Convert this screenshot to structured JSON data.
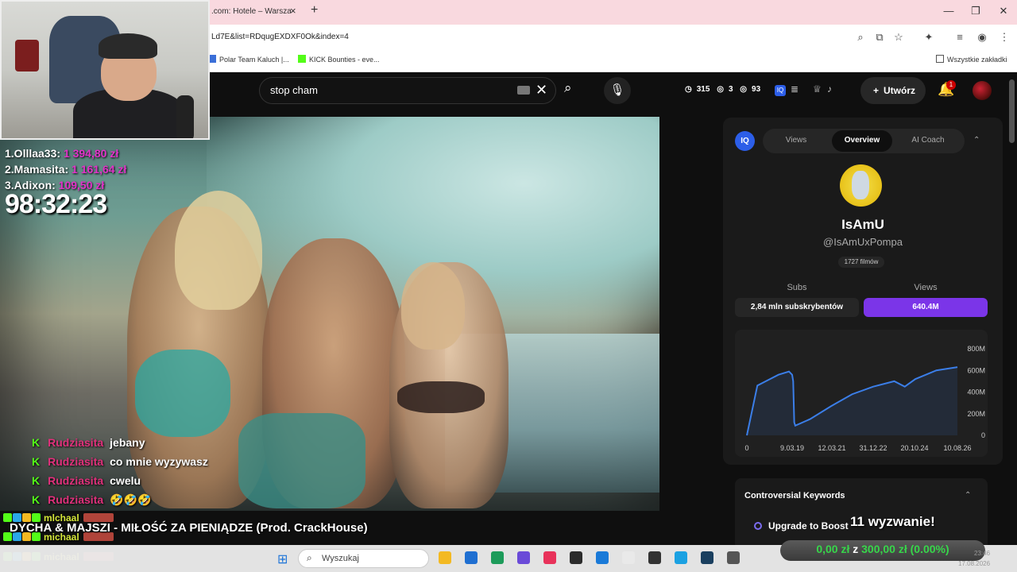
{
  "browser": {
    "tab_title": ".com: Hotele – Warsza",
    "tab_close": "×",
    "new_tab": "+",
    "window_controls": {
      "minimize": "—",
      "maximize": "❐",
      "close": "✕"
    },
    "url": "Ld7E&list=RDqugEXDXF0Ok&index=4",
    "bookmarks": [
      {
        "label": "Polar Team Kaluch |...",
        "icon": "bookmark-page-icon",
        "color": "#3b6fd8"
      },
      {
        "label": "KICK Bounties - eve...",
        "icon": "kick-icon",
        "color": "#53fc18"
      }
    ],
    "all_bookmarks": "Wszystkie zakładki"
  },
  "youtube": {
    "search_value": "stop cham",
    "stats": {
      "watch_time": "315",
      "views_a": "3",
      "views_b": "93"
    },
    "create_label": "Utwórz",
    "notifications": "1"
  },
  "overlay": {
    "leaderboard": [
      {
        "rank_name": "1.Olllaa33:",
        "amount": "1 394,80 zł"
      },
      {
        "rank_name": "2.Mamasita:",
        "amount": "1 161,64 zł"
      },
      {
        "rank_name": "3.Adixon:",
        "amount": "109,50 zł"
      }
    ],
    "timer": "98:32:23",
    "chat": [
      {
        "badge": "K",
        "user": "Rudziasita",
        "message": "jebany"
      },
      {
        "badge": "K",
        "user": "Rudziasita",
        "message": "co mnie wyzywasz"
      },
      {
        "badge": "K",
        "user": "Rudziasita",
        "message": "cwelu"
      },
      {
        "badge": "K",
        "user": "Rudziasita",
        "message": "🤣🤣🤣"
      }
    ],
    "song": "DYCHA & MAJSZI - MIŁOŚĆ ZA PIENIĄDZE (Prod. CrackHouse)",
    "kick_users": [
      "mlchaal",
      "michaal",
      "michaal"
    ],
    "challenge": "11 wyzwanie!",
    "goal": {
      "current": "0,00 zł",
      "sep": "z",
      "target": "300,00 zł",
      "percent": "(0.00%)"
    }
  },
  "panel": {
    "logo": "IQ",
    "tabs": [
      "Views",
      "Overview",
      "AI Coach"
    ],
    "active_tab": "Overview",
    "channel_name": "IsAmU",
    "channel_handle": "@IsAmUxPompa",
    "video_count": "1727 filmów",
    "subs_label": "Subs",
    "views_label": "Views",
    "subs_value": "2,84 mln subskrybentów",
    "views_value": "640.4M",
    "keywords_title": "Controversial Keywords",
    "upgrade_label": "Upgrade to Boost",
    "colors": {
      "accent": "#7b35e8",
      "logo": "#2c5ee8",
      "line": "#3b7ee8"
    }
  },
  "chart_data": {
    "type": "line",
    "x_ticks": [
      "0",
      "9.03.19",
      "12.03.21",
      "31.12.22",
      "20.10.24",
      "10.08.26"
    ],
    "y_ticks": [
      "0",
      "200M",
      "400M",
      "600M",
      "800M"
    ],
    "ylim": [
      0,
      800
    ],
    "x": [
      0,
      0.5,
      1,
      1.5,
      2,
      2.15,
      2.2,
      2.25,
      2.3,
      3,
      4,
      5,
      6,
      7,
      7.5,
      8,
      9,
      10
    ],
    "values": [
      0,
      460,
      510,
      560,
      590,
      560,
      500,
      120,
      90,
      150,
      270,
      380,
      450,
      500,
      450,
      520,
      600,
      630
    ],
    "grid": false
  },
  "taskbar": {
    "search_placeholder": "Wyszukaj",
    "time": "23:46",
    "date": "17.08.2026",
    "apps": [
      "#f3b922",
      "#1f6fd1",
      "#1d9b5a",
      "#6a4ad8",
      "#e8325a",
      "#2b2b2b",
      "#1a7ad8",
      "#e9e9e9",
      "#333333",
      "#1ba1e2",
      "#1a3f5f",
      "#555555"
    ]
  }
}
